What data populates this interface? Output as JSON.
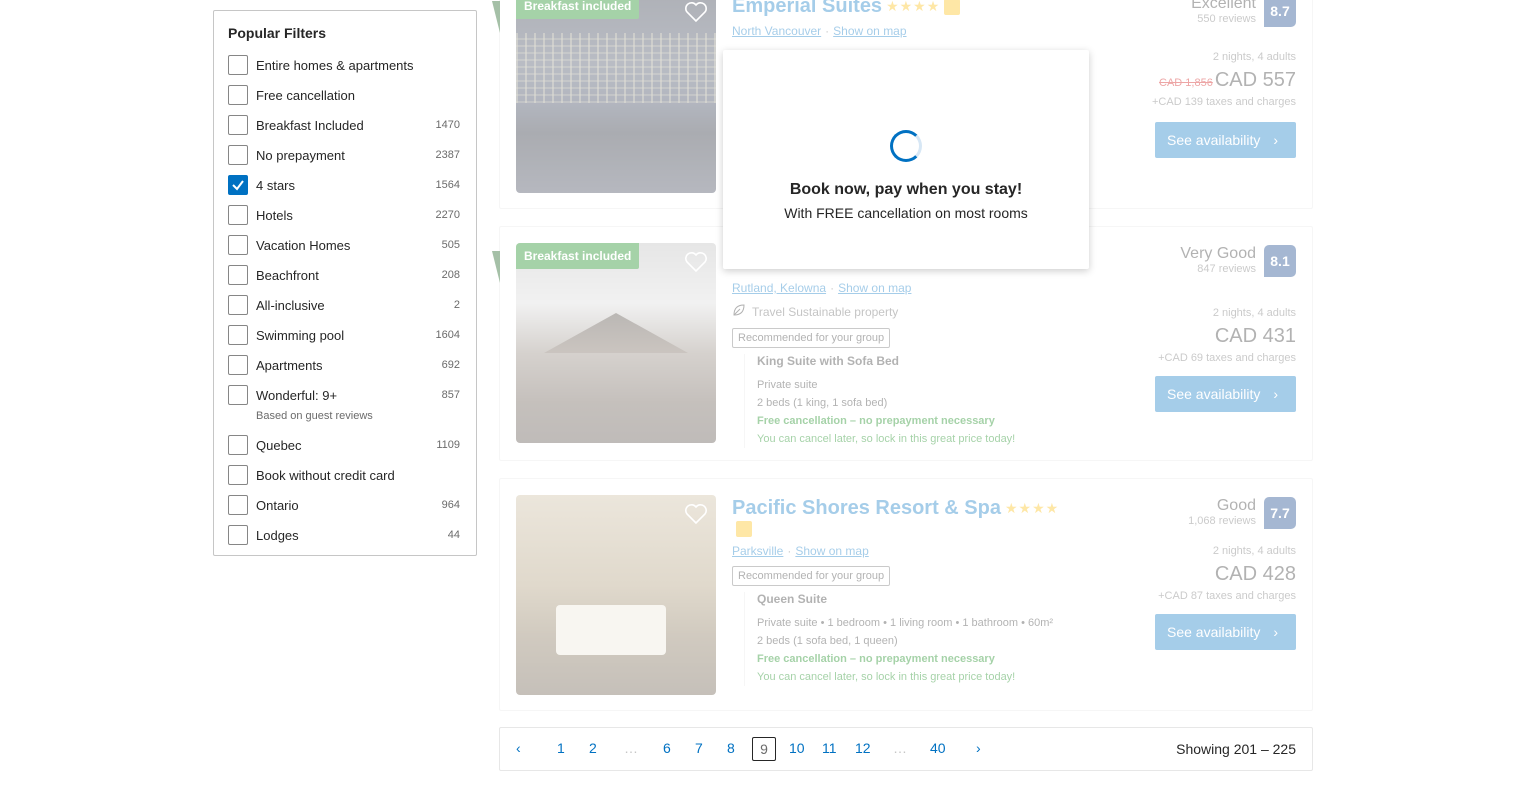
{
  "filters": {
    "title": "Popular Filters",
    "items": [
      {
        "label": "Entire homes & apartments",
        "count": "",
        "checked": false
      },
      {
        "label": "Free cancellation",
        "count": "",
        "checked": false
      },
      {
        "label": "Breakfast Included",
        "count": "1470",
        "checked": false
      },
      {
        "label": "No prepayment",
        "count": "2387",
        "checked": false
      },
      {
        "label": "4 stars",
        "count": "1564",
        "checked": true
      },
      {
        "label": "Hotels",
        "count": "2270",
        "checked": false
      },
      {
        "label": "Vacation Homes",
        "count": "505",
        "checked": false
      },
      {
        "label": "Beachfront",
        "count": "208",
        "checked": false
      },
      {
        "label": "All-inclusive",
        "count": "2",
        "checked": false
      },
      {
        "label": "Swimming pool",
        "count": "1604",
        "checked": false
      },
      {
        "label": "Apartments",
        "count": "692",
        "checked": false
      },
      {
        "label": "Wonderful: 9+",
        "count": "857",
        "checked": false
      },
      {
        "label": "Quebec",
        "count": "1109",
        "checked": false
      },
      {
        "label": "Book without credit card",
        "count": "",
        "checked": false
      },
      {
        "label": "Ontario",
        "count": "964",
        "checked": false
      },
      {
        "label": "Lodges",
        "count": "44",
        "checked": false
      }
    ],
    "wonderful_note": "Based on guest reviews"
  },
  "cards": [
    {
      "badge": "Breakfast included",
      "name": "Emperial Suites",
      "stars": "★★★★",
      "location": "North Vancouver",
      "map": "Show on map",
      "review_word": "Excellent",
      "review_count": "550 reviews",
      "score": "8.7",
      "nights": "2 nights, 4 adults",
      "old_price": "CAD 1,856",
      "price": "CAD 557",
      "taxes": "+CAD 139 taxes and charges",
      "button": "See availability"
    },
    {
      "badge": "Breakfast included",
      "location": "Rutland, Kelowna",
      "map": "Show on map",
      "sustainable": "Travel Sustainable property",
      "recommended": "Recommended for your group",
      "room_name": "King Suite with Sofa Bed",
      "room_type": "Private suite",
      "beds": "2 beds (1 king, 1 sofa bed)",
      "free_cancel": "Free cancellation – no prepayment necessary",
      "cancel_note": "You can cancel later, so lock in this great price today!",
      "review_word": "Very Good",
      "review_count": "847 reviews",
      "score": "8.1",
      "nights": "2 nights, 4 adults",
      "price": "CAD 431",
      "taxes": "+CAD 69 taxes and charges",
      "button": "See availability"
    },
    {
      "name": "Pacific Shores Resort & Spa",
      "stars": "★★★★",
      "location": "Parksville",
      "map": "Show on map",
      "recommended": "Recommended for your group",
      "room_name": "Queen Suite",
      "room_type": "Private suite • 1 bedroom • 1 living room • 1 bathroom • 60m²",
      "beds": "2 beds (1 sofa bed, 1 queen)",
      "free_cancel": "Free cancellation – no prepayment necessary",
      "cancel_note": "You can cancel later, so lock in this great price today!",
      "review_word": "Good",
      "review_count": "1,068 reviews",
      "score": "7.7",
      "nights": "2 nights, 4 adults",
      "price": "CAD 428",
      "taxes": "+CAD 87 taxes and charges",
      "button": "See availability"
    }
  ],
  "modal": {
    "title": "Book now, pay when you stay!",
    "subtitle": "With FREE cancellation on most rooms"
  },
  "pagination": {
    "prev": "‹",
    "next": "›",
    "pages": [
      "1",
      "2",
      "…",
      "6",
      "7",
      "8",
      "9",
      "10",
      "11",
      "12",
      "…",
      "40"
    ],
    "current": "9",
    "showing": "Showing 201 – 225"
  },
  "colors": {
    "brand_blue": "#0071c2",
    "score_blue": "#003580",
    "green": "#008009",
    "star_yellow": "#febb02"
  }
}
